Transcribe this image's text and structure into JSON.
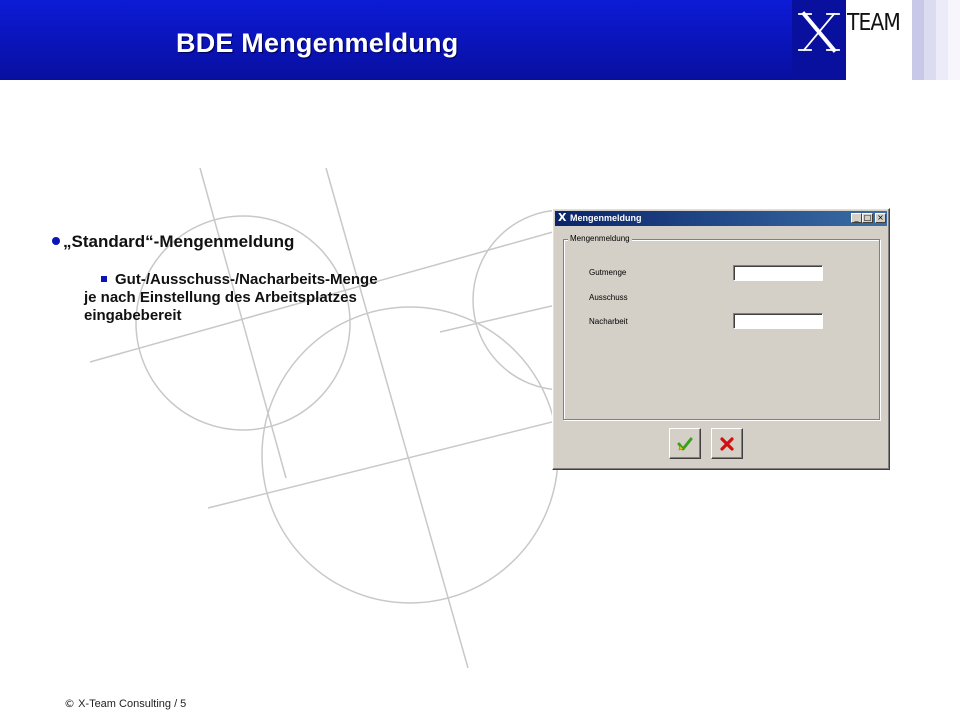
{
  "slide": {
    "title": "BDE Mengenmeldung",
    "logo_text": "TEAM",
    "logo_mark": "X"
  },
  "bullets": {
    "level1": "„Standard“-Mengenmeldung",
    "level2_line1": "Gut-/Ausschuss-/Nacharbeits-Menge",
    "level2_line2": "je nach Einstellung des Arbeitsplatzes",
    "level2_line3": "eingabebereit"
  },
  "dialog": {
    "title": "Mengenmeldung",
    "title_icon": "x-app-icon",
    "group_label": "Mengenmeldung",
    "fields": [
      {
        "label": "Gutmenge",
        "value": "",
        "has_input": true
      },
      {
        "label": "Ausschuss",
        "value": "",
        "has_input": false
      },
      {
        "label": "Nacharbeit",
        "value": "",
        "has_input": true
      }
    ],
    "buttons": {
      "ok_icon": "green-check-arrow-icon",
      "cancel_icon": "red-x-icon"
    },
    "window_buttons": {
      "minimize": "_",
      "maximize": "□",
      "close": "×"
    }
  },
  "footer": {
    "copyright_symbol": "©",
    "text": "X-Team Consulting",
    "page": "/ 5"
  },
  "colors": {
    "header_blue": "#0a14b8",
    "bullet_blue": "#0a14b8",
    "dialog_face": "#d4d0c8",
    "titlebar_start": "#0a246a",
    "titlebar_end": "#3a6ea5",
    "ok_green": "#3aa020",
    "cancel_red": "#d01010"
  }
}
